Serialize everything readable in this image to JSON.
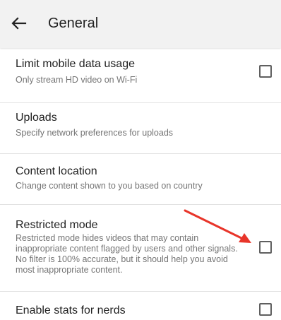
{
  "header": {
    "back_icon": "arrow-left-icon",
    "title": "General"
  },
  "settings": [
    {
      "title": "Limit mobile data usage",
      "subtitle": "Only stream HD video on Wi-Fi",
      "has_checkbox": true,
      "checked": false
    },
    {
      "title": "Uploads",
      "subtitle": "Specify network preferences for uploads",
      "has_checkbox": false
    },
    {
      "title": "Content location",
      "subtitle": "Change content shown to you based on country",
      "has_checkbox": false
    },
    {
      "title": "Restricted mode",
      "subtitle": "Restricted mode hides videos that may contain inappropriate content flagged by users and other signals. No filter is 100%  accurate, but it should help you avoid most inappropriate content.",
      "has_checkbox": true,
      "checked": false
    },
    {
      "title": "Enable stats for nerds",
      "has_checkbox": true,
      "checked": false
    }
  ],
  "annotation": {
    "icon": "red-arrow-icon",
    "color": "#e8352a"
  },
  "colors": {
    "appbar": "#f2f2f2",
    "subtitle": "#757575",
    "checkbox_border": "#5f5f5f"
  }
}
